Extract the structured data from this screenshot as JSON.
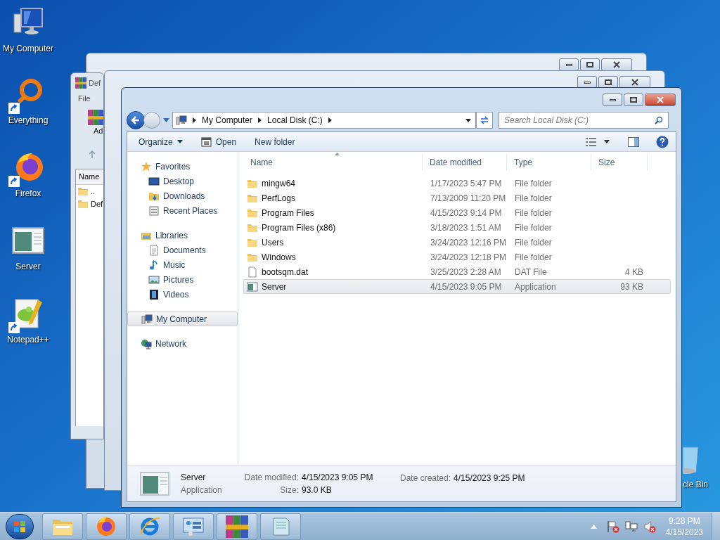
{
  "desktop_icons": [
    {
      "label": "My Computer",
      "kind": "computer",
      "shortcut": false
    },
    {
      "label": "Everything",
      "kind": "everything",
      "shortcut": true
    },
    {
      "label": "Firefox",
      "kind": "firefox",
      "shortcut": true
    },
    {
      "label": "Server",
      "kind": "app",
      "shortcut": false
    },
    {
      "label": "Notepad++",
      "kind": "notepad",
      "shortcut": true
    },
    {
      "label": "cle Bin",
      "kind": "recycle",
      "shortcut": false
    }
  ],
  "archive_window": {
    "title": "Def",
    "menu": [
      "File"
    ],
    "toolbar_label": "Ad",
    "column": "Name",
    "rows": [
      "..",
      "Def"
    ]
  },
  "explorer": {
    "address": [
      "My Computer",
      "Local Disk (C:)"
    ],
    "search": {
      "placeholder": "Search Local Disk (C:)"
    },
    "toolbar": [
      {
        "label": "Organize",
        "kind": "menu"
      },
      {
        "label": "Open",
        "kind": "open"
      },
      {
        "label": "New folder",
        "kind": "plain"
      }
    ],
    "navigation": [
      {
        "label": "Favorites",
        "kind": "star",
        "selected": false,
        "children": [
          {
            "label": "Desktop",
            "kind": "desktop",
            "selected": false
          },
          {
            "label": "Downloads",
            "kind": "downloads",
            "selected": false
          },
          {
            "label": "Recent Places",
            "kind": "recent",
            "selected": false
          }
        ]
      },
      {
        "label": "Libraries",
        "kind": "library",
        "selected": false,
        "children": [
          {
            "label": "Documents",
            "kind": "documents",
            "selected": false
          },
          {
            "label": "Music",
            "kind": "music",
            "selected": false
          },
          {
            "label": "Pictures",
            "kind": "pictures",
            "selected": false
          },
          {
            "label": "Videos",
            "kind": "videos",
            "selected": false
          }
        ]
      },
      {
        "label": "My Computer",
        "kind": "computer",
        "selected": true
      },
      {
        "label": "Network",
        "kind": "network",
        "selected": false
      }
    ],
    "columns": [
      "Name",
      "Date modified",
      "Type",
      "Size"
    ],
    "rows": [
      {
        "name": "mingw64",
        "date": "1/17/2023 5:47 PM",
        "type": "File folder",
        "kind": "folder",
        "selected": false
      },
      {
        "name": "PerfLogs",
        "date": "7/13/2009 11:20 PM",
        "type": "File folder",
        "kind": "folder",
        "selected": false
      },
      {
        "name": "Program Files",
        "date": "4/15/2023 9:14 PM",
        "type": "File folder",
        "kind": "folder",
        "selected": false
      },
      {
        "name": "Program Files (x86)",
        "date": "3/18/2023 1:51 AM",
        "type": "File folder",
        "kind": "folder",
        "selected": false
      },
      {
        "name": "Users",
        "date": "3/24/2023 12:16 PM",
        "type": "File folder",
        "kind": "folder",
        "selected": false
      },
      {
        "name": "Windows",
        "date": "3/24/2023 12:18 PM",
        "type": "File folder",
        "kind": "folder",
        "selected": false
      },
      {
        "name": "bootsqm.dat",
        "date": "3/25/2023 2:28 AM",
        "type": "DAT File",
        "size": "4 KB",
        "kind": "file",
        "selected": false
      },
      {
        "name": "Server",
        "date": "4/15/2023 9:05 PM",
        "type": "Application",
        "size": "93 KB",
        "kind": "app",
        "selected": true
      }
    ],
    "details": {
      "name": "Server",
      "type": "Application",
      "fields": [
        {
          "label": "Date modified:",
          "value": "4/15/2023 9:05 PM"
        },
        {
          "label": "Size:",
          "value": "93.0 KB"
        },
        {
          "label": "Date created:",
          "value": "4/15/2023 9:25 PM"
        }
      ]
    }
  },
  "taskbar": {
    "apps": [
      {
        "kind": "explorer"
      },
      {
        "kind": "firefox"
      },
      {
        "kind": "ie"
      },
      {
        "kind": "app"
      },
      {
        "kind": "winrar"
      },
      {
        "kind": "notepad"
      }
    ],
    "time": "9:28 PM",
    "date": "4/15/2023"
  }
}
